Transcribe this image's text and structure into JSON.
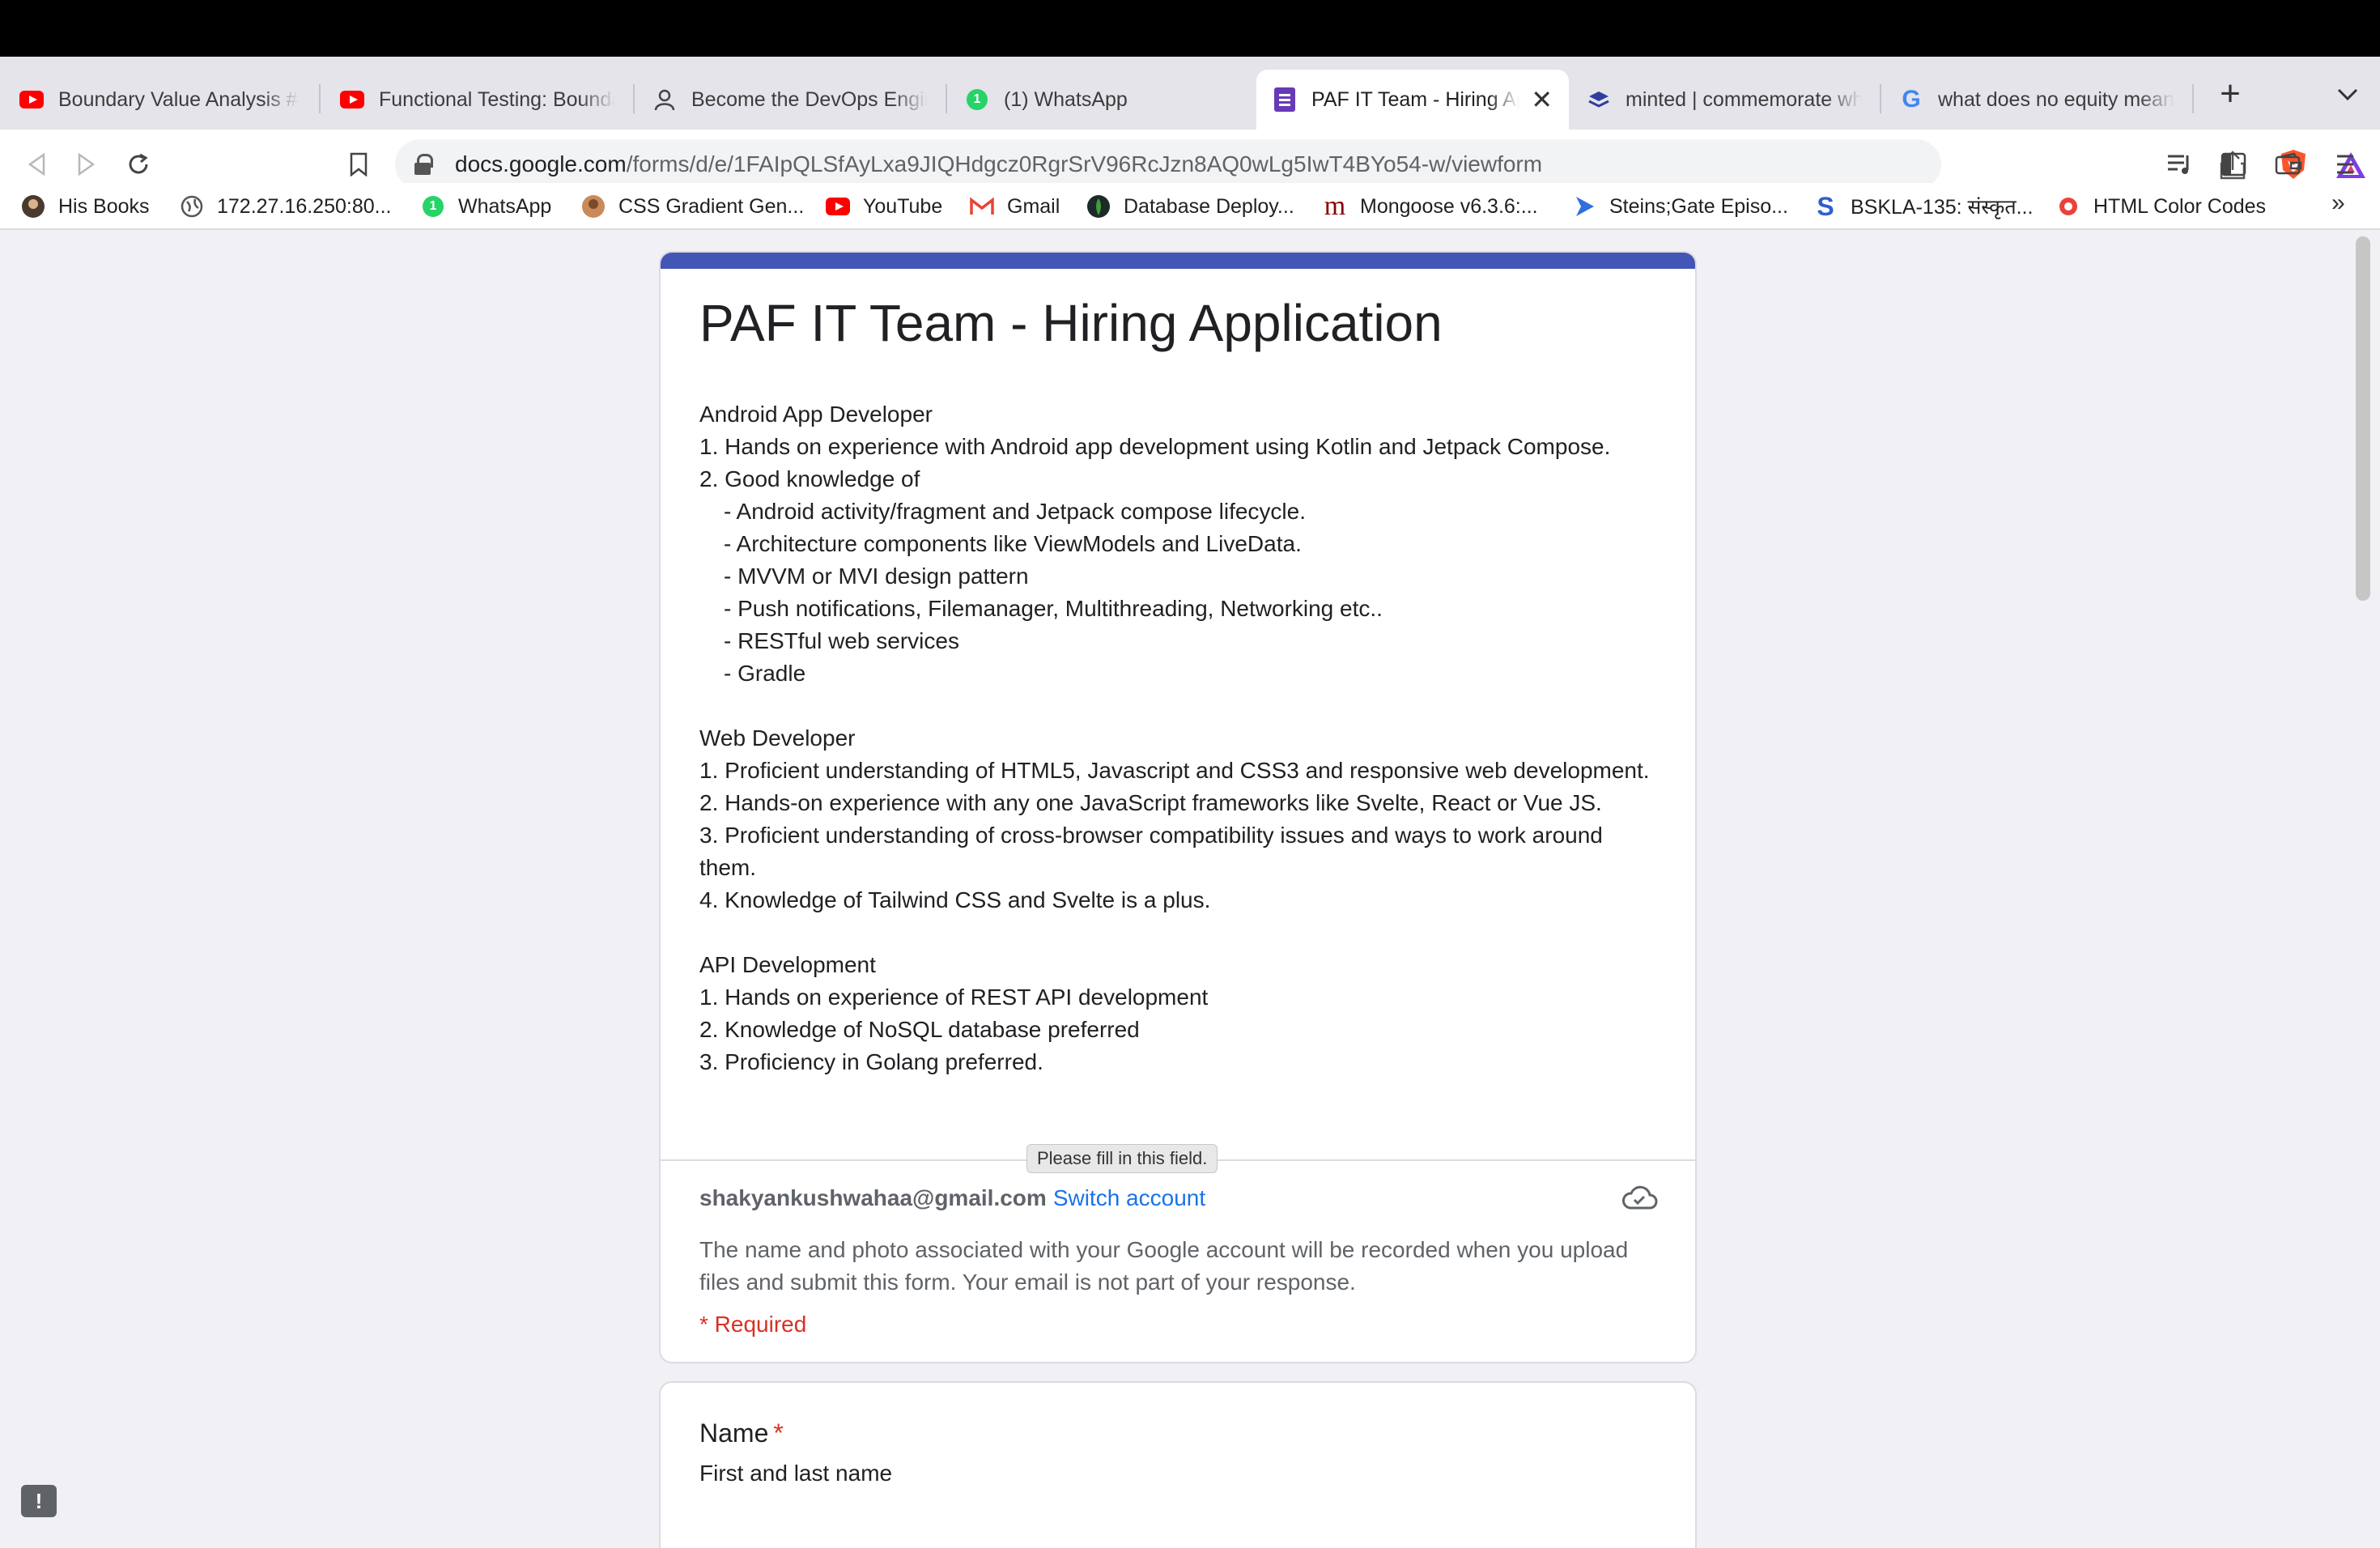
{
  "browser": {
    "tabs": [
      {
        "title": "Boundary Value Analysis #P",
        "icon": "youtube-icon"
      },
      {
        "title": "Functional Testing: Boundar",
        "icon": "youtube-icon"
      },
      {
        "title": "Become the DevOps Engine",
        "icon": "devops-icon"
      },
      {
        "title": "(1) WhatsApp",
        "icon": "whatsapp-icon"
      },
      {
        "title": "PAF IT Team - Hiring Ap",
        "icon": "forms-icon",
        "active": true
      },
      {
        "title": "minted | commemorate wha",
        "icon": "minted-icon"
      },
      {
        "title": "what does no equity mean i",
        "icon": "google-icon"
      }
    ],
    "address": {
      "host": "docs.google.com",
      "path": "/forms/d/e/1FAIpQLSfAyLxa9JIQHdgcz0RgrSrV96RcJzn8AQ0wLg5IwT4BYo54-w/viewform"
    },
    "whatsapp_badge": "1",
    "bookmarks": [
      {
        "label": "His Books",
        "icon": "avatar-icon"
      },
      {
        "label": "172.27.16.250:80...",
        "icon": "globe-icon"
      },
      {
        "label": "WhatsApp",
        "icon": "whatsapp-icon"
      },
      {
        "label": "CSS Gradient Gen...",
        "icon": "avatar-icon"
      },
      {
        "label": "YouTube",
        "icon": "youtube-icon"
      },
      {
        "label": "Gmail",
        "icon": "gmail-icon"
      },
      {
        "label": "Database Deploy...",
        "icon": "mongodb-icon"
      },
      {
        "label": "Mongoose v6.3.6:...",
        "icon": "mongoose-icon"
      },
      {
        "label": "Steins;Gate Episo...",
        "icon": "play-icon"
      },
      {
        "label": "BSKLA-135: संस्कृत...",
        "icon": "s-icon"
      },
      {
        "label": "HTML Color Codes",
        "icon": "color-icon"
      }
    ],
    "bookmarks_more": "»"
  },
  "form": {
    "title": "PAF IT Team - Hiring Application",
    "description": [
      {
        "text": "Android App Developer",
        "indent": false
      },
      {
        "text": "1. Hands on experience with Android app development using Kotlin and Jetpack Compose.",
        "indent": false
      },
      {
        "text": "2. Good knowledge of",
        "indent": false
      },
      {
        "text": "- Android activity/fragment and Jetpack compose lifecycle.",
        "indent": true
      },
      {
        "text": "- Architecture components like ViewModels and LiveData.",
        "indent": true
      },
      {
        "text": "- MVVM or MVI design pattern",
        "indent": true
      },
      {
        "text": "- Push notifications, Filemanager, Multithreading, Networking etc..",
        "indent": true
      },
      {
        "text": "- RESTful web services",
        "indent": true
      },
      {
        "text": "- Gradle",
        "indent": true
      },
      {
        "text": "",
        "indent": false
      },
      {
        "text": "Web Developer",
        "indent": false
      },
      {
        "text": "1. Proficient understanding of HTML5, Javascript and CSS3 and responsive web development.",
        "indent": false,
        "wrap": true
      },
      {
        "text": "2. Hands-on experience with any one JavaScript frameworks like Svelte, React or Vue JS.",
        "indent": false
      },
      {
        "text": "3. Proficient understanding of cross-browser compatibility issues and ways to work around them.",
        "indent": false,
        "wrap": true
      },
      {
        "text": "4. Knowledge of Tailwind CSS and Svelte is a plus.",
        "indent": false
      },
      {
        "text": "",
        "indent": false
      },
      {
        "text": "API Development",
        "indent": false
      },
      {
        "text": "1. Hands on experience of REST API development",
        "indent": false
      },
      {
        "text": "2. Knowledge of NoSQL database preferred",
        "indent": false
      },
      {
        "text": "3. Proficiency in Golang preferred.",
        "indent": false
      }
    ],
    "account_email": "shakyankushwahaa@gmail.com",
    "switch_account": "Switch account",
    "tooltip": "Please fill in this field.",
    "notice": "The name and photo associated with your Google account will be recorded when you upload files and submit this form. Your email is not part of your response.",
    "required_note": "* Required",
    "questions": [
      {
        "title": "Name",
        "required_mark": "*",
        "help": "First and last name"
      }
    ]
  },
  "colors": {
    "accent": "#4355b5",
    "required": "#d93025",
    "link": "#1a73e8"
  }
}
